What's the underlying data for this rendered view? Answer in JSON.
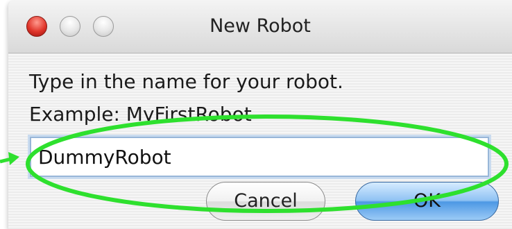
{
  "window": {
    "title": "New Robot",
    "controls": [
      "close-icon",
      "minimize-icon",
      "zoom-icon"
    ]
  },
  "dialog": {
    "prompt": "Type in the name for your robot.",
    "example": "Example: MyFirstRobot",
    "name_value": "DummyRobot",
    "cancel_label": "Cancel",
    "ok_label": "OK"
  },
  "annotation": {
    "highlight_color": "#2ee02e"
  }
}
